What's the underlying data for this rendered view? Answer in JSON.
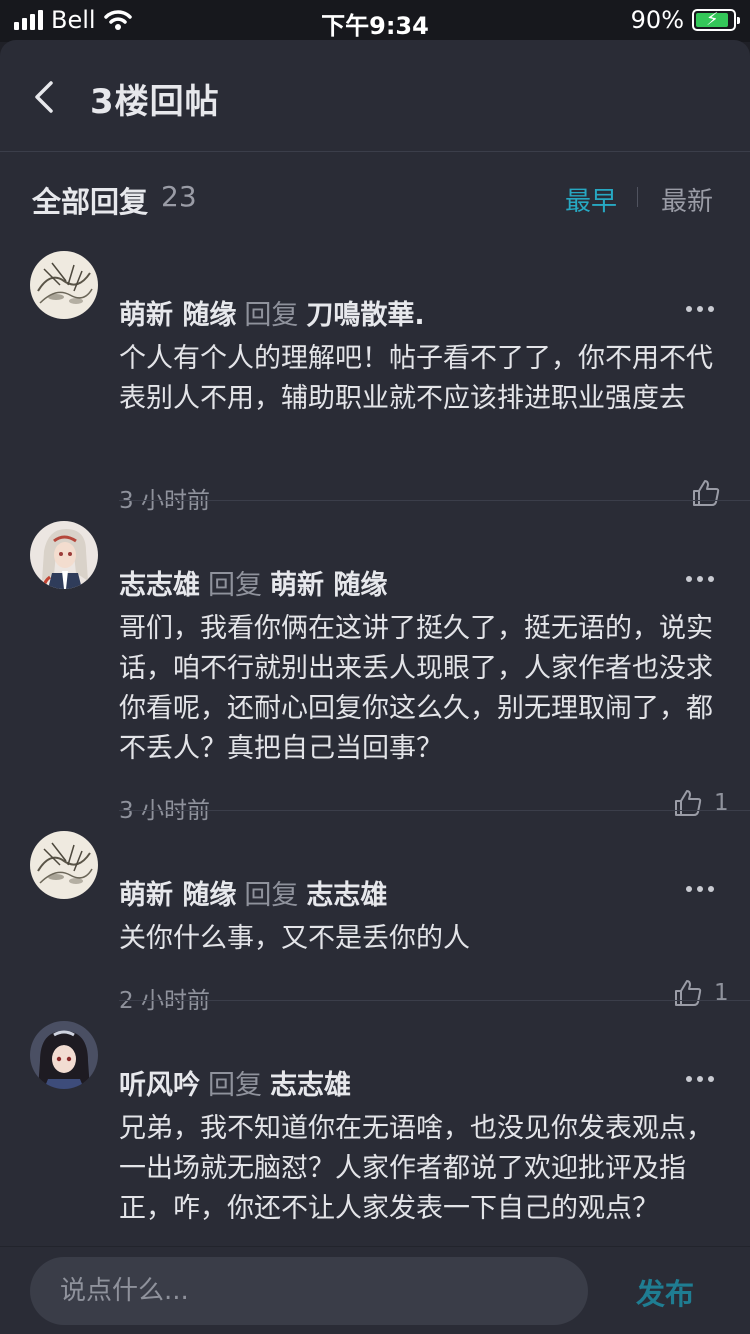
{
  "status_bar": {
    "carrier": "Bell",
    "time": "下午9:34",
    "battery": "90%",
    "battery_level": 0.9
  },
  "nav": {
    "title": "3楼回帖"
  },
  "replies_header": {
    "title": "全部回复",
    "count": "23",
    "sort_earliest": "最早",
    "sort_latest": "最新"
  },
  "comments": [
    {
      "author": "萌新 随缘",
      "reply_word": "回复",
      "target": "刀鳴散華.",
      "text": "个人有个人的理解吧！帖子看不了了，你不用不代表别人不用，辅助职业就不应该排进职业强度去",
      "time": "3 小时前",
      "likes": ""
    },
    {
      "author": "志志雄",
      "reply_word": "回复",
      "target": "萌新 随缘",
      "text": "哥们，我看你俩在这讲了挺久了，挺无语的，说实话，咱不行就别出来丢人现眼了，人家作者也没求你看呢，还耐心回复你这么久，别无理取闹了，都不丢人？真把自己当回事？",
      "time": "3 小时前",
      "likes": "1"
    },
    {
      "author": "萌新 随缘",
      "reply_word": "回复",
      "target": "志志雄",
      "text": "关你什么事，又不是丢你的人",
      "time": "2 小时前",
      "likes": "1"
    },
    {
      "author": "听风吟",
      "reply_word": "回复",
      "target": "志志雄",
      "text": "兄弟，我不知道你在无语啥，也没见你发表观点，一出场就无脑怼？人家作者都说了欢迎批评及指正，咋，你还不让人家发表一下自己的观点？",
      "time": "",
      "likes": ""
    }
  ],
  "composer": {
    "placeholder": "说点什么...",
    "publish_label": "发布"
  },
  "colors": {
    "accent": "#27a8c2",
    "background": "#2a2c36",
    "publish": "#1f7d92"
  }
}
